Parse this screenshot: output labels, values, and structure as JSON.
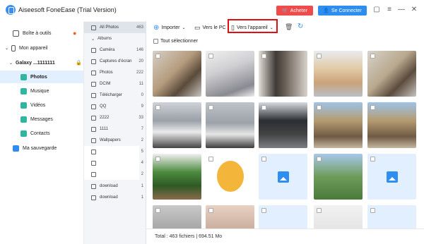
{
  "app": {
    "title": "Aiseesoft FoneEase (Trial Version)"
  },
  "header": {
    "buy_label": "Acheter",
    "login_label": "Se Connecter"
  },
  "sidebar": {
    "toolbox": "Boîte à outils",
    "my_device": "Mon appareil",
    "device_name": "Galaxy ...1111111",
    "items": [
      "Photos",
      "Musique",
      "Vidéos",
      "Messages",
      "Contacts"
    ],
    "backup": "Ma sauvegarde"
  },
  "albums": {
    "all_photos": {
      "label": "All Photos",
      "count": "463"
    },
    "section": "Albums",
    "list": [
      {
        "label": "Caméra",
        "count": "146"
      },
      {
        "label": "Captures d'écran",
        "count": "20"
      },
      {
        "label": "Photos",
        "count": "222"
      },
      {
        "label": "DCIM",
        "count": "11"
      },
      {
        "label": "Télécharger",
        "count": "0"
      },
      {
        "label": "QQ",
        "count": "9"
      },
      {
        "label": "2222",
        "count": "33"
      },
      {
        "label": "1111",
        "count": "7"
      },
      {
        "label": "Wallpapers",
        "count": "2"
      },
      {
        "label": "",
        "count": "5"
      },
      {
        "label": "",
        "count": "4"
      },
      {
        "label": "",
        "count": "2"
      },
      {
        "label": "download",
        "count": "1"
      },
      {
        "label": "download",
        "count": "1"
      }
    ]
  },
  "toolbar": {
    "import_label": "Importer",
    "to_pc_label": "Vers le PC",
    "to_device_label": "Vers l'appareil",
    "select_all_label": "Tout sélectionner"
  },
  "footer": {
    "total": "Total : 463 fichiers | 694.51 Mo"
  },
  "colors": {
    "accent": "#2d8ef0",
    "buy": "#f04b4b",
    "highlight": "#e01010"
  }
}
